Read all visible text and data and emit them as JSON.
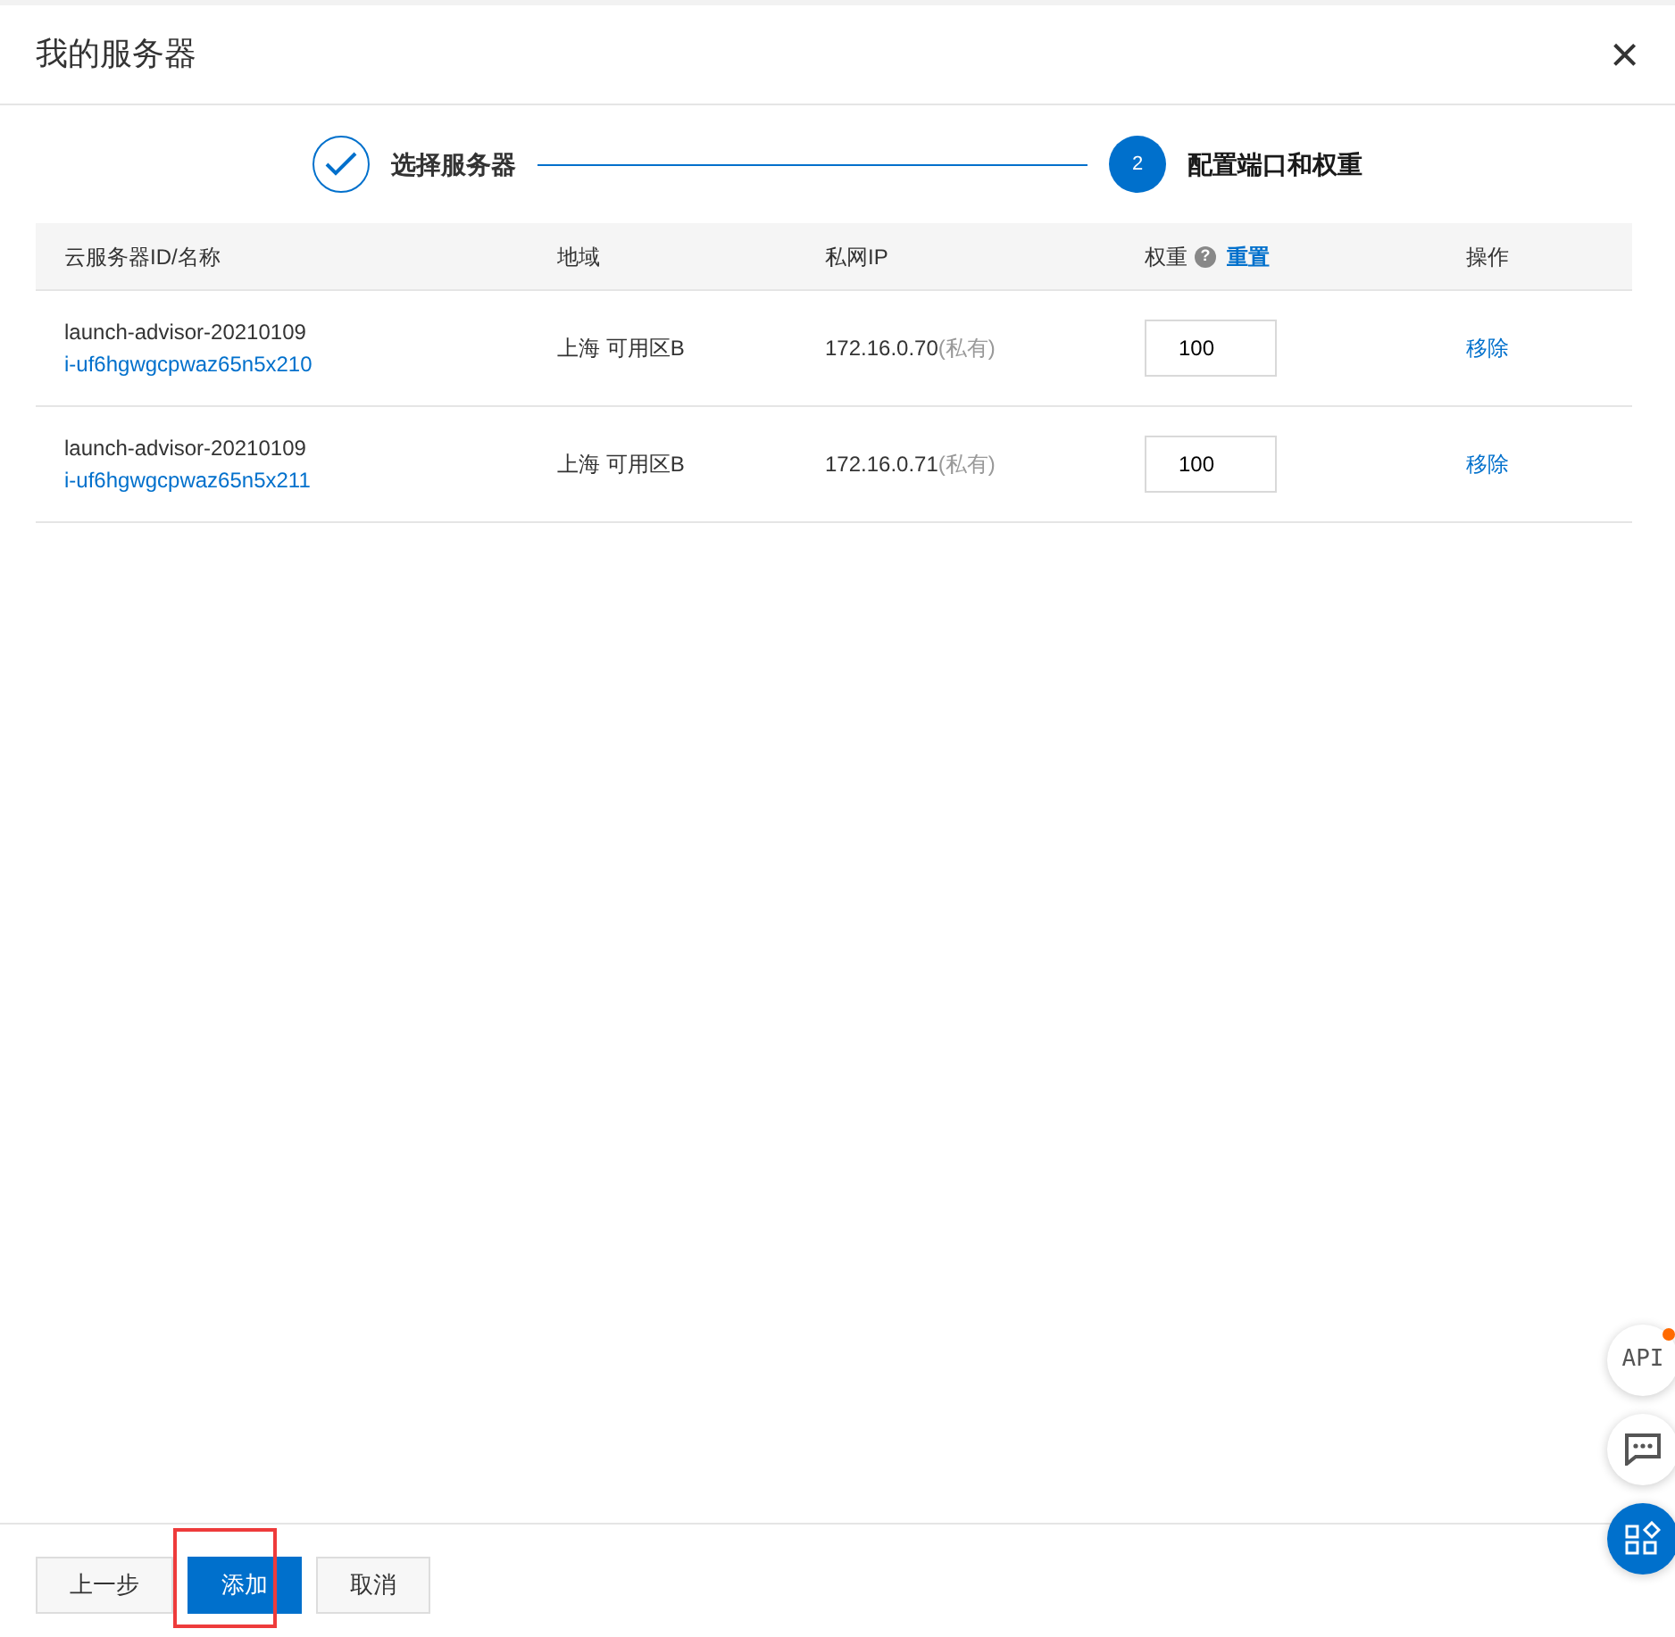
{
  "dialog": {
    "title": "我的服务器",
    "close": "×"
  },
  "steps": [
    {
      "label": "选择服务器",
      "done": true,
      "selected": false
    },
    {
      "label": "配置端口和权重",
      "number": "2",
      "done": false,
      "selected": true
    }
  ],
  "table": {
    "columns": [
      {
        "label": "云服务器ID/名称"
      },
      {
        "label": "地域"
      },
      {
        "label": "私网IP"
      },
      {
        "label": "权重",
        "help": "?",
        "action": "重置"
      },
      {
        "label": "操作"
      }
    ],
    "rows": [
      {
        "name": "launch-advisor-20210109",
        "id": "i-uf6hgwgcpwaz65n5x210",
        "region": "上海 可用区B",
        "ip": "172.16.0.70",
        "ip_type": "(私有)",
        "weight": "100",
        "action": "移除"
      },
      {
        "name": "launch-advisor-20210109",
        "id": "i-uf6hgwgcpwaz65n5x211",
        "region": "上海 可用区B",
        "ip": "172.16.0.71",
        "ip_type": "(私有)",
        "weight": "100",
        "action": "移除"
      }
    ]
  },
  "footer": {
    "buttons": [
      {
        "label": "上一步",
        "kind": "default",
        "highlighted": false
      },
      {
        "label": "添加",
        "kind": "primary",
        "highlighted": true
      },
      {
        "label": "取消",
        "kind": "default",
        "highlighted": false
      }
    ]
  },
  "floating": [
    {
      "kind": "api",
      "label": "API",
      "notify": true
    },
    {
      "kind": "chat"
    },
    {
      "kind": "apps"
    }
  ]
}
